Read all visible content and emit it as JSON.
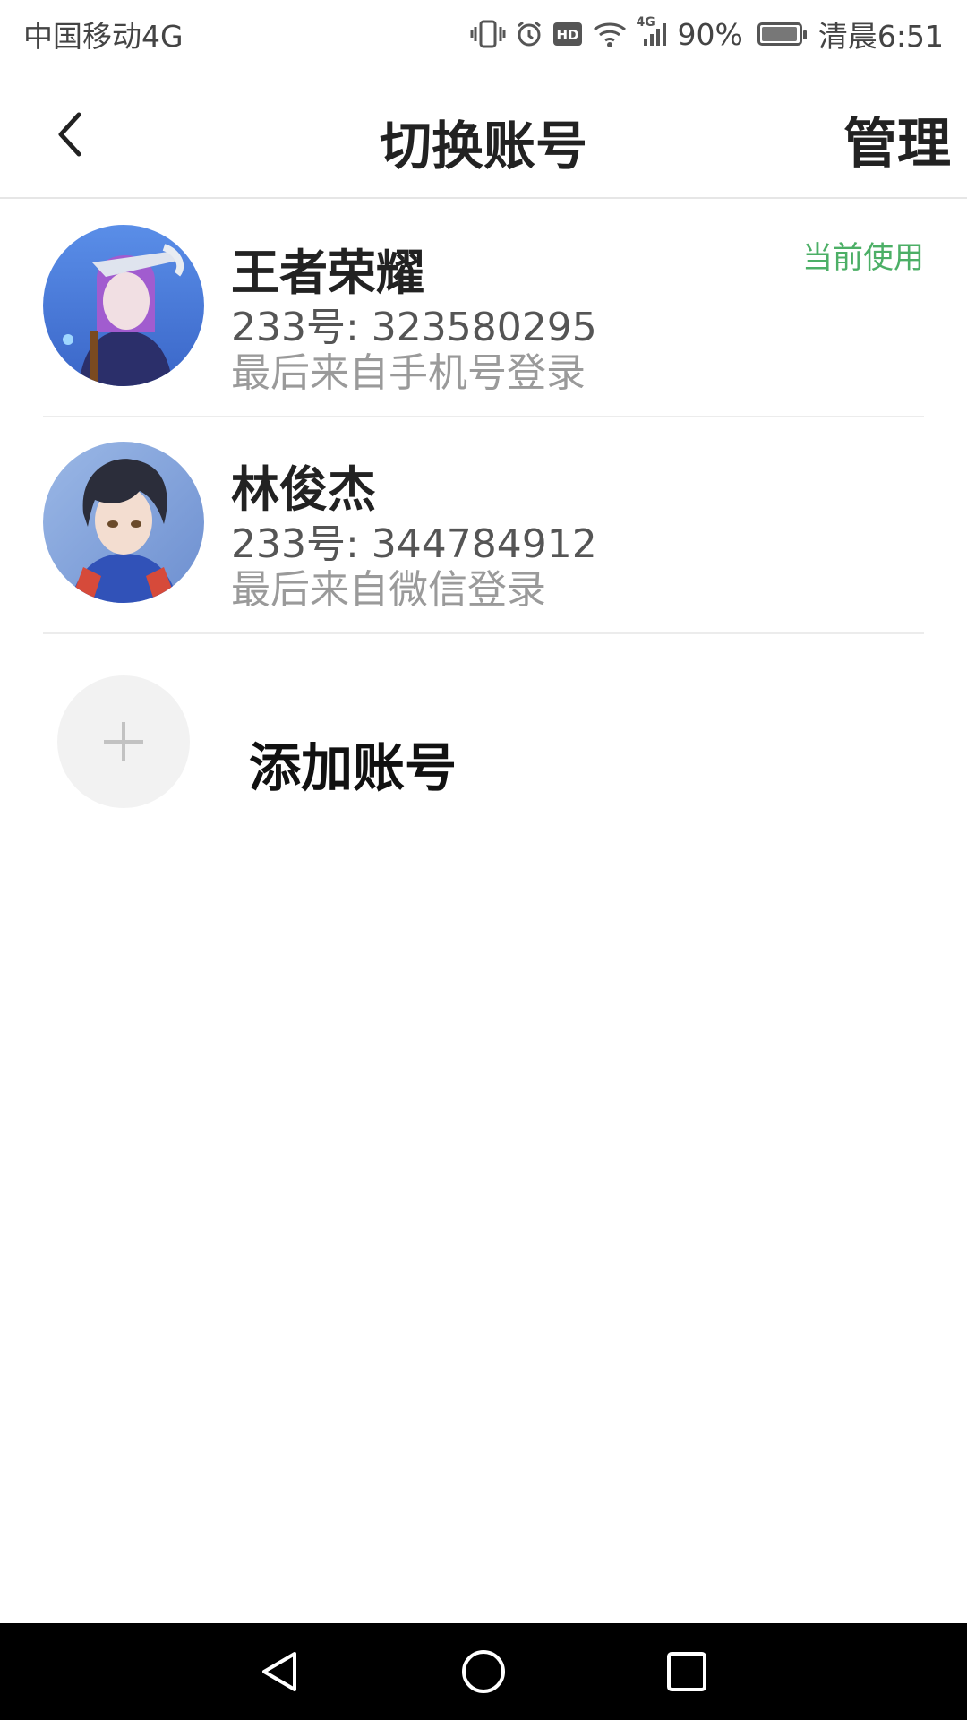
{
  "status_bar": {
    "carrier": "中国移动4G",
    "network_small": "4G",
    "battery": "90%",
    "time": "清晨6:51",
    "icons": [
      "vibrate-icon",
      "alarm-icon",
      "hd-icon",
      "wifi-icon",
      "signal-icon",
      "battery-icon"
    ]
  },
  "header": {
    "title": "切换账号",
    "manage_label": "管理",
    "back_icon": "chevron-left-icon"
  },
  "accounts": [
    {
      "name": "王者荣耀",
      "id_text": "233号: 323580295",
      "login_text": "最后来自手机号登录",
      "badge": "当前使用"
    },
    {
      "name": "林俊杰",
      "id_text": "233号: 344784912",
      "login_text": "最后来自微信登录"
    }
  ],
  "add_account": {
    "label": "添加账号",
    "icon": "plus-icon"
  },
  "colors": {
    "accent_green": "#4caf66",
    "nav_bar": "#000000"
  },
  "nav_bar": {
    "buttons": [
      "back-triangle-icon",
      "home-circle-icon",
      "recents-square-icon"
    ]
  }
}
